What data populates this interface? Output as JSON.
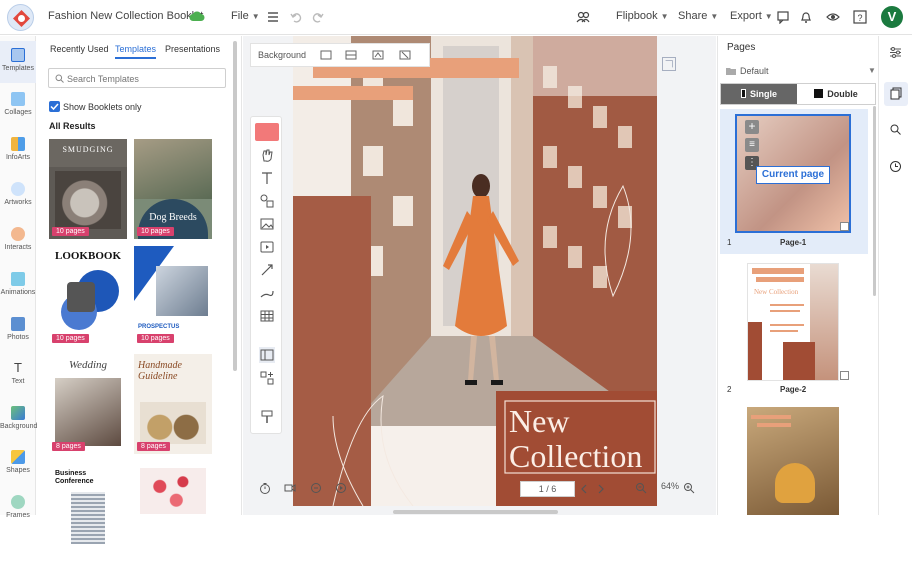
{
  "header": {
    "title": "Fashion New Collection Booklet",
    "file_label": "File",
    "flipbook_label": "Flipbook",
    "share_label": "Share",
    "export_label": "Export",
    "avatar_initial": "V"
  },
  "left_nav": [
    {
      "label": "Templates",
      "icon": "templates-icon"
    },
    {
      "label": "Collages",
      "icon": "collages-icon"
    },
    {
      "label": "InfoArts",
      "icon": "infoarts-icon"
    },
    {
      "label": "Artworks",
      "icon": "artworks-icon"
    },
    {
      "label": "Interacts",
      "icon": "interacts-icon"
    },
    {
      "label": "Animations",
      "icon": "animations-icon"
    },
    {
      "label": "Photos",
      "icon": "photos-icon"
    },
    {
      "label": "Text",
      "icon": "text-icon"
    },
    {
      "label": "Background",
      "icon": "background-icon"
    },
    {
      "label": "Shapes",
      "icon": "shapes-icon"
    },
    {
      "label": "Frames",
      "icon": "frames-icon"
    }
  ],
  "templates_panel": {
    "tabs": [
      "Recently Used",
      "Templates",
      "Presentations"
    ],
    "active_tab": "Templates",
    "search_placeholder": "Search Templates",
    "show_booklets_label": "Show Booklets only",
    "all_results_label": "All Results",
    "items": [
      {
        "title": "SMUDGING",
        "pages": "10 pages"
      },
      {
        "title": "Dog Breeds",
        "pages": "10 pages"
      },
      {
        "title": "LOOKBOOK",
        "pages": "10 pages"
      },
      {
        "title": "PROSPECTUS",
        "pages": "10 pages"
      },
      {
        "title": "Wedding",
        "pages": "8 pages"
      },
      {
        "title": "Handmade Guideline",
        "pages": "8 pages"
      },
      {
        "title": "Business Conference",
        "pages": ""
      },
      {
        "title": "",
        "pages": ""
      }
    ]
  },
  "canvas": {
    "background_label": "Background",
    "headline_line1": "New",
    "headline_line2": "Collection",
    "page_indicator": "1 / 6",
    "zoom": "64%"
  },
  "pages_panel": {
    "title": "Pages",
    "default_label": "Default",
    "single_label": "Single",
    "double_label": "Double",
    "current_page_label": "Current page",
    "page1_number": "1",
    "page1_name": "Page-1",
    "page2_number": "2",
    "page2_name": "Page-2",
    "mini_headline": "New Collection"
  },
  "colors": {
    "accent": "#2b6fd6",
    "badge": "#d8416d",
    "rust": "#a4513a",
    "peach": "#e8a07a",
    "green_avatar": "#1b7a3f"
  }
}
